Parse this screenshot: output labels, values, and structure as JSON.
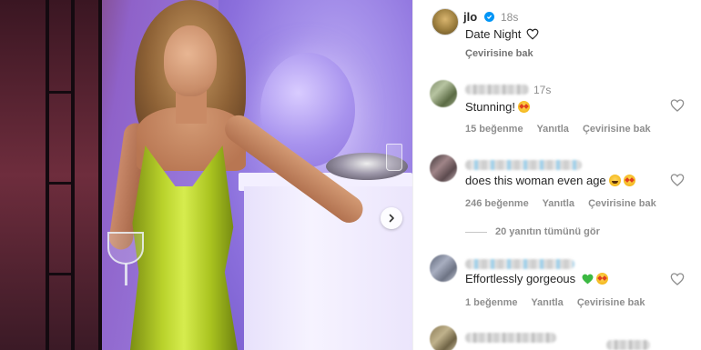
{
  "post": {
    "username": "jlo",
    "time": "18s",
    "caption": "Date Night",
    "caption_icon": "heart-outline-icon",
    "see_translation": "Çevirisine bak",
    "next_icon": "chevron-right-icon"
  },
  "comments": [
    {
      "username_visible": "17s",
      "text": "Stunning!",
      "emoji": [
        "star-struck"
      ],
      "likes": "15 beğenme",
      "reply": "Yanıtla",
      "see_translation": "Çevirisine bak"
    },
    {
      "username_visible": "",
      "text": "does this woman even age",
      "emoji": [
        "grinning-sweat",
        "star-struck"
      ],
      "likes": "246 beğenme",
      "reply": "Yanıtla",
      "see_translation": "Çevirisine bak",
      "view_replies": "20 yanıtın tümünü gör"
    },
    {
      "username_visible": "",
      "text": "Effortlessly gorgeous",
      "emoji": [
        "green-heart",
        "star-struck"
      ],
      "likes": "1 beğenme",
      "reply": "Yanıtla",
      "see_translation": "Çevirisine bak"
    }
  ],
  "colors": {
    "verified": "#0095f6",
    "dress": "#b9d22b",
    "background_light": "#9a7fe0",
    "muted_text": "#8e8e8e"
  }
}
